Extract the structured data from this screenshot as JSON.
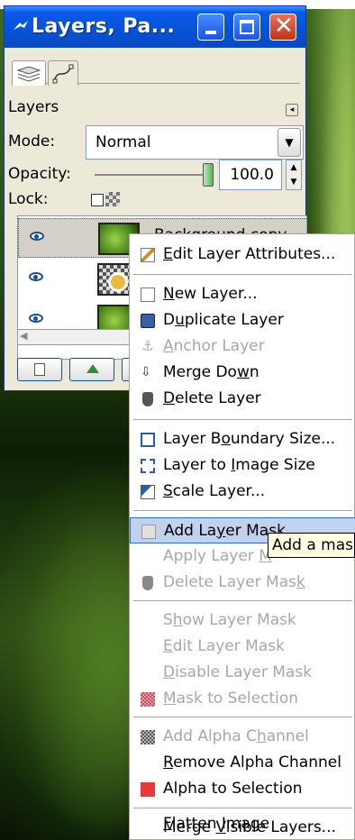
{
  "window": {
    "title": "Layers, Pa..."
  },
  "panel": {
    "section_label": "Layers",
    "mode_label": "Mode:",
    "mode_value": "Normal",
    "opacity_label": "Opacity:",
    "opacity_value": "100.0",
    "opacity_fraction": 1.0,
    "lock_label": "Lock:"
  },
  "layers": [
    {
      "name": "Background copy",
      "visible": true,
      "selected": true
    },
    {
      "name": "",
      "visible": true,
      "selected": false
    },
    {
      "name": "",
      "visible": true,
      "selected": false
    }
  ],
  "context_menu": {
    "items": [
      {
        "icon": "edit-icon",
        "pre": "",
        "key": "E",
        "post": "dit Layer Attributes...",
        "enabled": true
      },
      {
        "icon": "new-layer-icon",
        "pre": "",
        "key": "N",
        "post": "ew Layer...",
        "enabled": true
      },
      {
        "icon": "duplicate-icon",
        "pre": "D",
        "key": "u",
        "post": "plicate Layer",
        "enabled": true
      },
      {
        "icon": "anchor-icon",
        "pre": "",
        "key": "A",
        "post": "nchor Layer",
        "enabled": false
      },
      {
        "icon": "merge-down-icon",
        "pre": "Merge Do",
        "key": "w",
        "post": "n",
        "enabled": true
      },
      {
        "icon": "delete-icon",
        "pre": "",
        "key": "D",
        "post": "elete Layer",
        "enabled": true
      },
      {
        "icon": "layer-boundary-icon",
        "pre": "Layer B",
        "key": "o",
        "post": "undary Size...",
        "enabled": true
      },
      {
        "icon": "layer-to-image-icon",
        "pre": "Layer to ",
        "key": "I",
        "post": "mage Size",
        "enabled": true
      },
      {
        "icon": "scale-icon",
        "pre": "",
        "key": "S",
        "post": "cale Layer...",
        "enabled": true
      },
      {
        "icon": "add-mask-icon",
        "pre": "Add La",
        "key": "y",
        "post": "er Mask...",
        "enabled": true,
        "highlighted": true
      },
      {
        "icon": "",
        "pre": "Apply Layer ",
        "key": "M",
        "post": "",
        "enabled": false
      },
      {
        "icon": "delete-icon",
        "pre": "Delete Layer Mas",
        "key": "k",
        "post": "",
        "enabled": false
      },
      {
        "icon": "",
        "pre": "S",
        "key": "h",
        "post": "ow Layer Mask",
        "enabled": false
      },
      {
        "icon": "",
        "pre": "",
        "key": "E",
        "post": "dit Layer Mask",
        "enabled": false
      },
      {
        "icon": "",
        "pre": "",
        "key": "D",
        "post": "isable Layer Mask",
        "enabled": false
      },
      {
        "icon": "mask-selection-icon",
        "pre": "",
        "key": "M",
        "post": "ask to Selection",
        "enabled": false
      },
      {
        "icon": "alpha-icon",
        "pre": "Add Alpha C",
        "key": "h",
        "post": "annel",
        "enabled": false
      },
      {
        "icon": "",
        "pre": "",
        "key": "R",
        "post": "emove Alpha Channel",
        "enabled": true
      },
      {
        "icon": "alpha-selection-icon",
        "pre": "Alpha to Selection",
        "key": "",
        "post": "",
        "enabled": true
      },
      {
        "icon": "",
        "pre": "Merge ",
        "key": "V",
        "post": "isible Layers...",
        "enabled": true
      },
      {
        "icon": "",
        "pre": "",
        "key": "F",
        "post": "latten Image",
        "enabled": true
      }
    ]
  },
  "tooltip": {
    "text": "Add a mas"
  },
  "colors": {
    "titlebar": "#0752d6",
    "menu_highlight": "#c1d2ee",
    "tooltip_bg": "#ffffe1"
  }
}
